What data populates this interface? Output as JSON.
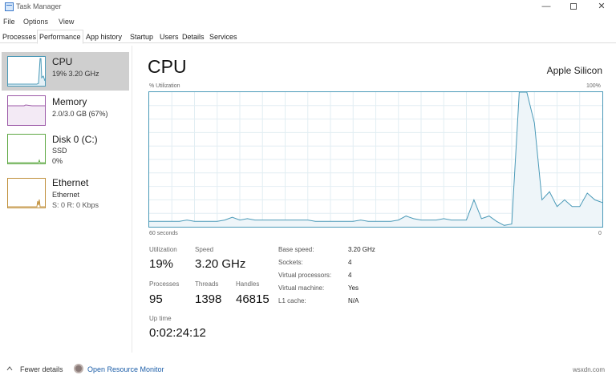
{
  "window": {
    "title": "Task Manager"
  },
  "menu": [
    "File",
    "Options",
    "View"
  ],
  "tabs": [
    {
      "label": "Processes",
      "active": false
    },
    {
      "label": "Performance",
      "active": true
    },
    {
      "label": "App history",
      "active": false
    },
    {
      "label": "Startup",
      "active": false
    },
    {
      "label": "Users",
      "active": false
    },
    {
      "label": "Details",
      "active": false
    },
    {
      "label": "Services",
      "active": false
    }
  ],
  "sidebar": [
    {
      "name": "CPU",
      "sub1": "19%  3.20 GHz",
      "sub2": "",
      "color": "#4b9ab8",
      "selected": true
    },
    {
      "name": "Memory",
      "sub1": "2.0/3.0 GB (67%)",
      "sub2": "",
      "color": "#9c5aa8",
      "selected": false
    },
    {
      "name": "Disk 0 (C:)",
      "sub1": "SSD",
      "sub2": "0%",
      "color": "#5ea843",
      "selected": false
    },
    {
      "name": "Ethernet",
      "sub1": "Ethernet",
      "sub2": "S: 0  R: 0 Kbps",
      "color": "#c08f3a",
      "selected": false
    }
  ],
  "main": {
    "title": "CPU",
    "model": "Apple Silicon",
    "graph_top_left": "% Utilization",
    "graph_top_right": "100%",
    "graph_bottom_left": "60 seconds",
    "graph_bottom_right": "0"
  },
  "chart_data": {
    "type": "area",
    "ylim": [
      0,
      100
    ],
    "xlabel": "60 seconds",
    "ylabel": "% Utilization",
    "grid": true,
    "x": [
      0,
      1,
      2,
      3,
      4,
      5,
      6,
      7,
      8,
      9,
      10,
      11,
      12,
      13,
      14,
      15,
      16,
      17,
      18,
      19,
      20,
      21,
      22,
      23,
      24,
      25,
      26,
      27,
      28,
      29,
      30,
      31,
      32,
      33,
      34,
      35,
      36,
      37,
      38,
      39,
      40,
      41,
      42,
      43,
      44,
      45,
      46,
      47,
      48,
      49,
      50,
      51,
      52,
      53,
      54,
      55,
      56,
      57,
      58,
      59,
      60
    ],
    "values": [
      4,
      4,
      4,
      4,
      4,
      5,
      4,
      4,
      4,
      4,
      5,
      7,
      5,
      6,
      5,
      5,
      5,
      5,
      5,
      5,
      5,
      5,
      4,
      4,
      4,
      4,
      4,
      4,
      5,
      4,
      4,
      4,
      4,
      5,
      8,
      6,
      5,
      5,
      5,
      6,
      5,
      5,
      5,
      20,
      6,
      8,
      4,
      1,
      2,
      100,
      100,
      77,
      20,
      26,
      15,
      20,
      15,
      15,
      25,
      20,
      18
    ],
    "color": "#4b9ab8",
    "fill": "#eef5f9"
  },
  "stats": {
    "utilization_label": "Utilization",
    "utilization": "19%",
    "speed_label": "Speed",
    "speed": "3.20 GHz",
    "processes_label": "Processes",
    "processes": "95",
    "threads_label": "Threads",
    "threads": "1398",
    "handles_label": "Handles",
    "handles": "46815",
    "uptime_label": "Up time",
    "uptime": "0:02:24:12"
  },
  "details": [
    {
      "label": "Base speed:",
      "value": "3.20 GHz"
    },
    {
      "label": "Sockets:",
      "value": "4"
    },
    {
      "label": "Virtual processors:",
      "value": "4"
    },
    {
      "label": "Virtual machine:",
      "value": "Yes"
    },
    {
      "label": "L1 cache:",
      "value": "N/A"
    }
  ],
  "footer": {
    "fewer_details": "Fewer details",
    "open_monitor": "Open Resource Monitor",
    "watermark": "wsxdn.com"
  }
}
